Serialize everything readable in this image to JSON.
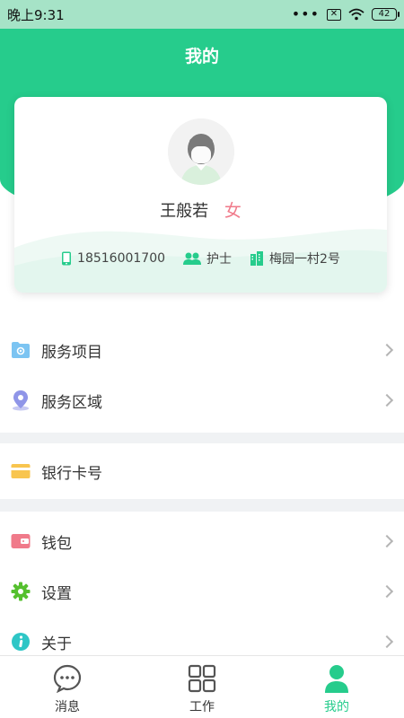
{
  "status_bar": {
    "time": "晚上9:31",
    "battery": "42",
    "icons": [
      "more-dots-icon",
      "no-sim-icon",
      "wifi-icon",
      "battery-icon"
    ]
  },
  "header": {
    "title": "我的"
  },
  "profile": {
    "name": "王般若",
    "gender": "女",
    "phone": "18516001700",
    "role": "护士",
    "address": "梅园一村2号",
    "icons": {
      "phone": "phone-icon",
      "role": "people-icon",
      "address": "building-icon"
    }
  },
  "menu": {
    "group1": [
      {
        "label": "服务项目",
        "icon": "folder-gear-icon"
      },
      {
        "label": "服务区域",
        "icon": "location-pin-icon"
      }
    ],
    "group2": [
      {
        "label": "银行卡号",
        "icon": "bank-card-icon"
      }
    ],
    "group3": [
      {
        "label": "钱包",
        "icon": "wallet-icon"
      },
      {
        "label": "设置",
        "icon": "gear-icon"
      },
      {
        "label": "关于",
        "icon": "info-icon"
      }
    ]
  },
  "tabs": [
    {
      "label": "消息",
      "icon": "chat-bubble-icon",
      "active": false
    },
    {
      "label": "工作",
      "icon": "grid-icon",
      "active": false
    },
    {
      "label": "我的",
      "icon": "person-icon",
      "active": true
    }
  ],
  "colors": {
    "accent": "#26cc8c",
    "status_bar": "#a6e3c7",
    "gender": "#f07a8a",
    "divider": "#f0f2f4"
  }
}
